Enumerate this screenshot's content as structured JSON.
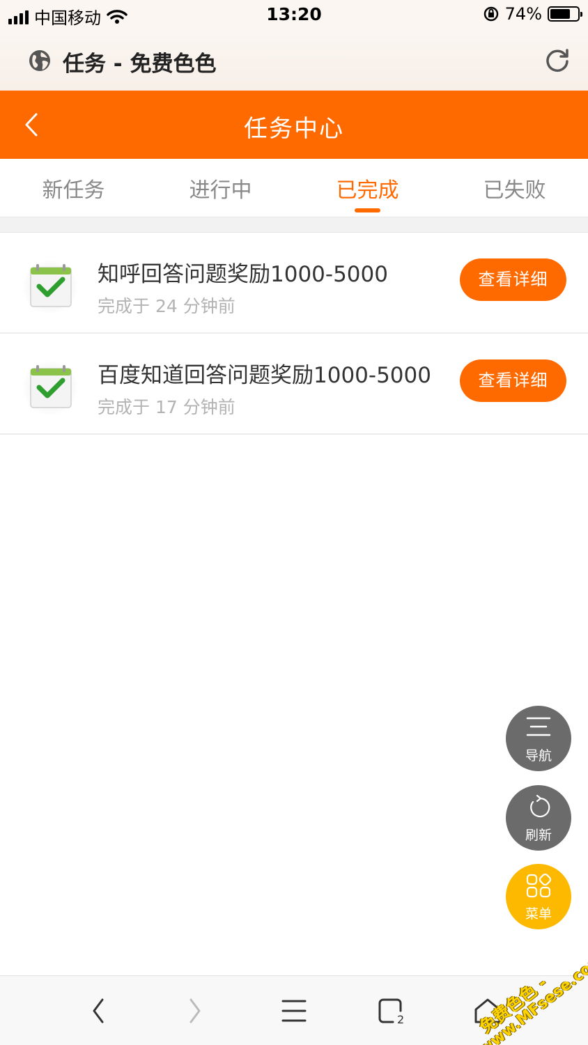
{
  "status_bar": {
    "carrier": "中国移动",
    "time": "13:20",
    "battery": "74%"
  },
  "browser": {
    "page_title": "任务 - 免费色色",
    "globe_icon": "globe-icon",
    "refresh_icon": "refresh-icon"
  },
  "header": {
    "title": "任务中心",
    "back_icon": "chevron-left-icon"
  },
  "tabs": [
    {
      "label": "新任务",
      "active": false
    },
    {
      "label": "进行中",
      "active": false
    },
    {
      "label": "已完成",
      "active": true
    },
    {
      "label": "已失败",
      "active": false
    }
  ],
  "tasks": [
    {
      "title": "知呼回答问题奖励1000-5000",
      "time": "完成于 24 分钟前",
      "button": "查看详细",
      "icon": "calendar-check-icon"
    },
    {
      "title": "百度知道回答问题奖励1000-5000",
      "time": "完成于 17 分钟前",
      "button": "查看详细",
      "icon": "calendar-check-icon"
    }
  ],
  "floating": {
    "nav_label": "导航",
    "refresh_label": "刷新",
    "menu_label": "菜单"
  },
  "colors": {
    "accent": "#ff6a00",
    "fab_gray": "#6b6b6b",
    "fab_yellow": "#fdb900"
  },
  "watermark": {
    "line1": "免费色色 -",
    "line2": "www.MFsese.com"
  }
}
